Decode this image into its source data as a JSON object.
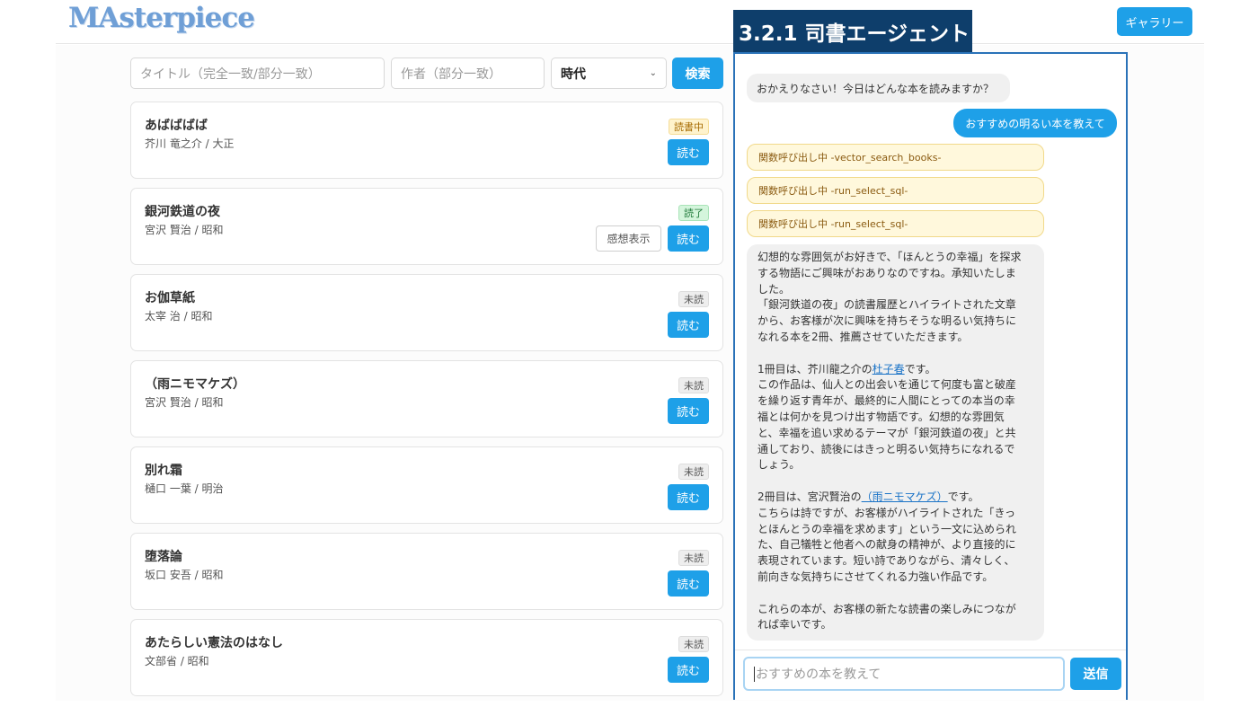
{
  "app": {
    "logo": "MAsterpiece",
    "gallery_label": "ギャラリー"
  },
  "search": {
    "title_placeholder": "タイトル（完全一致/部分一致）",
    "author_placeholder": "作者（部分一致）",
    "era_selected": "時代",
    "search_label": "検索"
  },
  "books": [
    {
      "title": "あばばばば",
      "meta": "芥川 竜之介 / 大正",
      "status": "読書中",
      "read_label": "読む"
    },
    {
      "title": "銀河鉄道の夜",
      "meta": "宮沢 賢治 / 昭和",
      "status": "読了",
      "review_label": "感想表示",
      "read_label": "読む"
    },
    {
      "title": "お伽草紙",
      "meta": "太宰 治 / 昭和",
      "status": "未読",
      "read_label": "読む"
    },
    {
      "title": "（雨ニモマケズ）",
      "meta": "宮沢 賢治 / 昭和",
      "status": "未読",
      "read_label": "読む"
    },
    {
      "title": "別れ霜",
      "meta": "樋口 一葉 / 明治",
      "status": "未読",
      "read_label": "読む"
    },
    {
      "title": "堕落論",
      "meta": "坂口 安吾 / 昭和",
      "status": "未読",
      "read_label": "読む"
    },
    {
      "title": "あたらしい憲法のはなし",
      "meta": "文部省 / 昭和",
      "status": "未読",
      "read_label": "読む"
    }
  ],
  "chat": {
    "section_label": "3.2.1 司書エージェント",
    "greeting": "おかえりなさい！今日はどんな本を読みますか？",
    "user_message": "おすすめの明るい本を教えて",
    "function_calls": [
      "関数呼び出し中 -vector_search_books-",
      "関数呼び出し中 -run_select_sql-",
      "関数呼び出し中 -run_select_sql-"
    ],
    "reply": {
      "p1_l1": "幻想的な雰囲気がお好きで、「ほんとうの幸福」を探求",
      "p1_l2": "する物語にご興味がおありなのですね。承知いたしま",
      "p1_l3": "した。",
      "p2_l1": "「銀河鉄道の夜」の読書履歴とハイライトされた文章",
      "p2_l2": "から、お客様が次に興味を持ちそうな明るい気持ちに",
      "p2_l3": "なれる本を2冊、推薦させていただきます。",
      "p3_pre": "1冊目は、芥川龍之介の",
      "p3_link": "杜子春",
      "p3_post": "です。",
      "p4_l1": "この作品は、仙人との出会いを通じて何度も富と破産",
      "p4_l2": "を繰り返す青年が、最終的に人間にとっての本当の幸",
      "p4_l3": "福とは何かを見つけ出す物語です。幻想的な雰囲気",
      "p4_l4": "と、幸福を追い求めるテーマが「銀河鉄道の夜」と共",
      "p4_l5": "通しており、読後にはきっと明るい気持ちになれるで",
      "p4_l6": "しょう。",
      "p5_pre": "2冊目は、宮沢賢治の",
      "p5_link": "（雨ニモマケズ）",
      "p5_post": "です。",
      "p6_l1": "こちらは詩ですが、お客様がハイライトされた「きっ",
      "p6_l2": "とほんとうの幸福を求めます」という一文に込められ",
      "p6_l3": "た、自己犠牲と他者への献身の精神が、より直接的に",
      "p6_l4": "表現されています。短い詩でありながら、清々しく、",
      "p6_l5": "前向きな気持ちにさせてくれる力強い作品です。",
      "p7_l1": "これらの本が、お客様の新たな読書の楽しみにつなが",
      "p7_l2": "れば幸いです。"
    },
    "input_placeholder": "おすすめの本を教えて",
    "send_label": "送信"
  }
}
